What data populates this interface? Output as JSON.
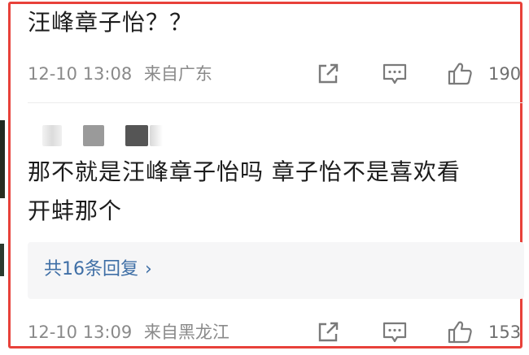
{
  "comment1": {
    "text": "汪峰章子怡？？",
    "timestamp": "12-10 13:08",
    "location": "来自广东",
    "like_count": "190"
  },
  "comment2": {
    "line1": "那不就是汪峰章子怡吗 章子怡不是喜欢看",
    "line2": "开蚌那个",
    "reply_label": "共16条回复",
    "reply_chevron": "›",
    "timestamp": "12-10 13:09",
    "location": "来自黑龙江",
    "like_count": "153"
  },
  "icons": {
    "share": "share-icon",
    "comment": "comment-icon",
    "like": "like-icon"
  },
  "colors": {
    "frame": "#e8413a",
    "link": "#3f6fa6",
    "meta": "#8a8a8a"
  }
}
